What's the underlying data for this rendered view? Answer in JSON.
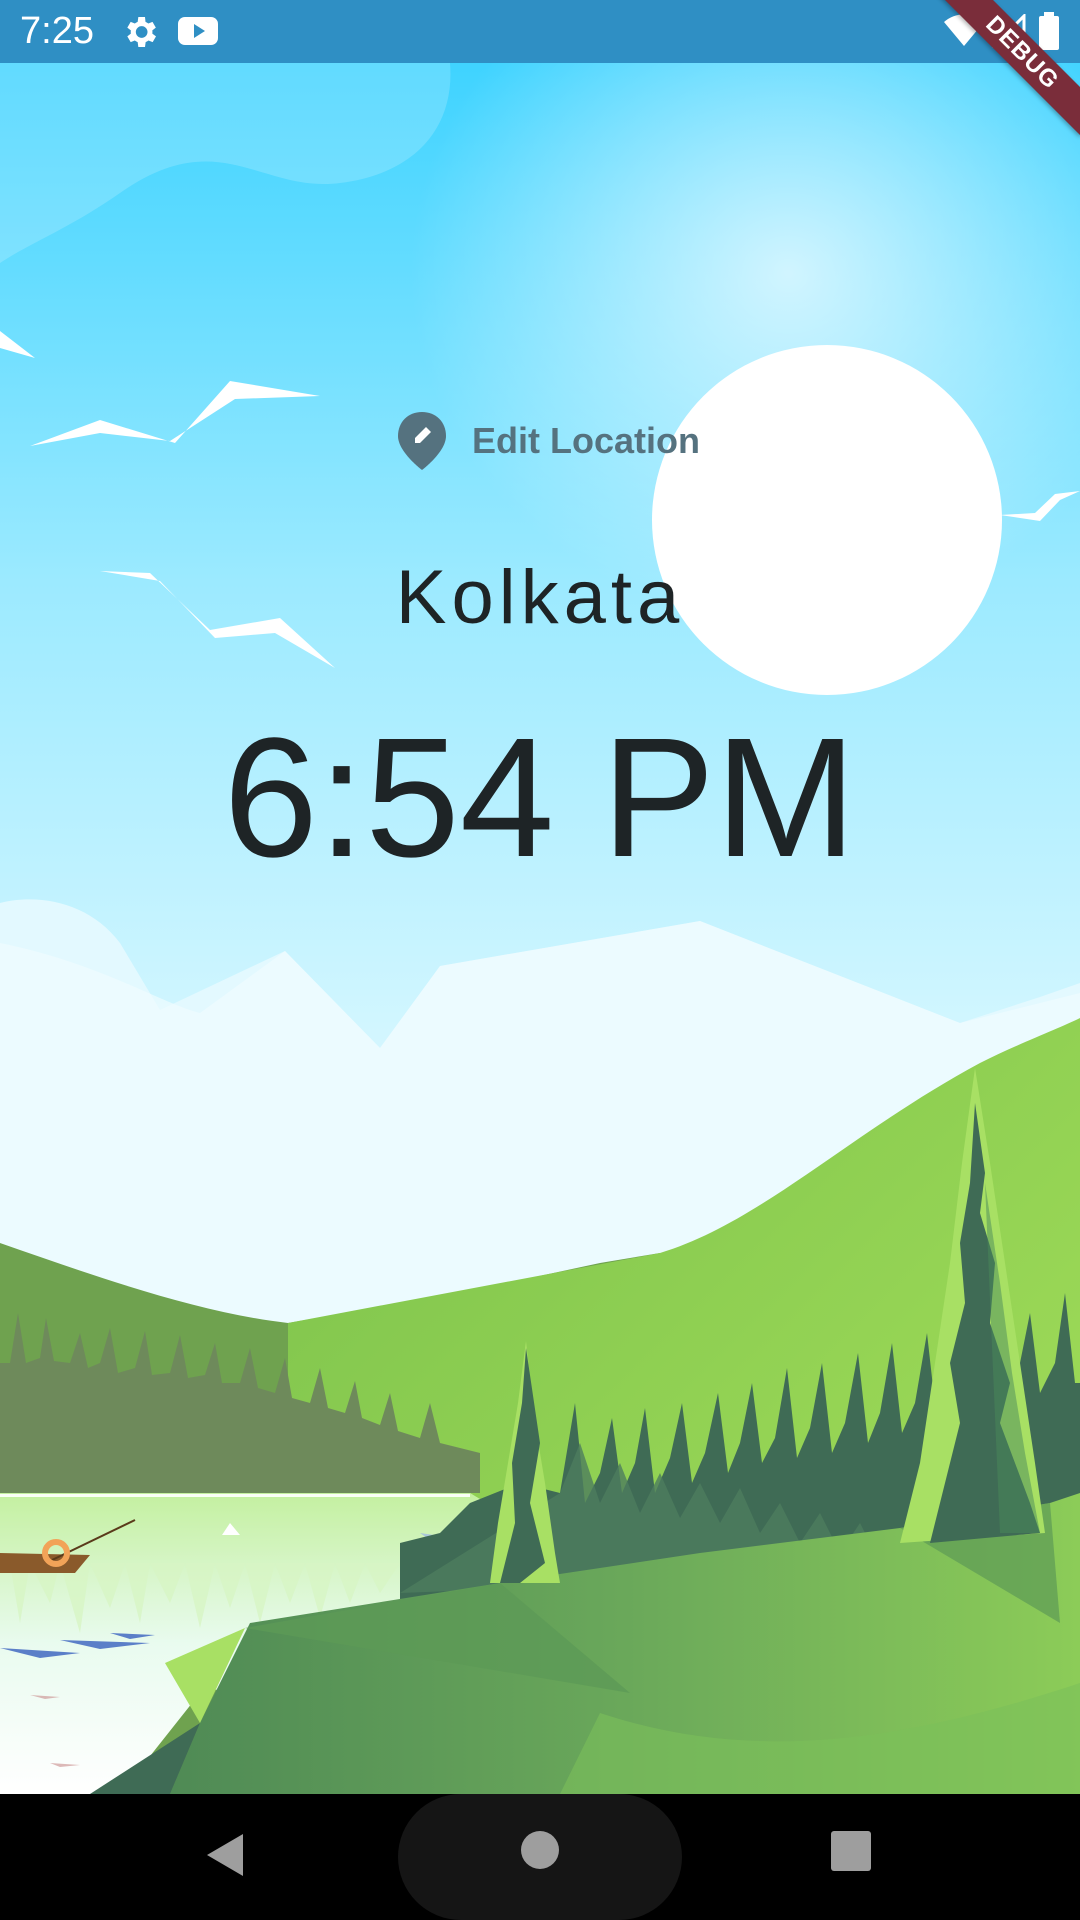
{
  "status_bar": {
    "time": "7:25",
    "icons": [
      "gear-icon",
      "youtube-icon",
      "wifi-icon",
      "signal-icon",
      "battery-icon"
    ]
  },
  "debug_banner": {
    "label": "DEBUG",
    "color": "#7a2d3a"
  },
  "location": {
    "edit_label": "Edit Location",
    "icon": "location-pin-edit-icon",
    "city": "Kolkata",
    "time": "6:54 PM"
  },
  "colors": {
    "status_bar": "#2f8fc4",
    "sky_top": "#3fd3ff",
    "sun": "#ffffff",
    "text_dark": "#1e2426",
    "edit_label": "#55727f"
  },
  "nav_bar": {
    "icons": [
      "back-icon",
      "home-icon",
      "recents-icon"
    ]
  }
}
